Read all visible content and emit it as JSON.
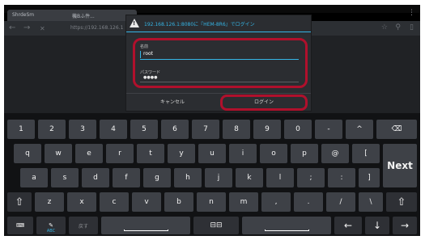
{
  "browser": {
    "tabs": [
      "ShrdeSm",
      "機Bふ件..."
    ],
    "url": "https://192.168.126.1",
    "nav_icons": {
      "back": "←",
      "forward": "→",
      "close": "✕",
      "star": "☆",
      "search": "⚲",
      "menu": "⋮"
    }
  },
  "dialog": {
    "title": "192.168.126.1:8080に『HEM-8R6』でログイン",
    "name_label": "名前",
    "name_value": "root",
    "password_label": "パスワード",
    "password_value": "●●●●",
    "cancel_label": "キャンセル",
    "login_label": "ログイン"
  },
  "keyboard": {
    "row1": [
      "1",
      "2",
      "3",
      "4",
      "5",
      "6",
      "7",
      "8",
      "9",
      "0",
      "-",
      "^",
      "⌫"
    ],
    "row2": [
      "q",
      "w",
      "e",
      "r",
      "t",
      "y",
      "u",
      "i",
      "o",
      "p",
      "@",
      "["
    ],
    "row2_enter": "Next",
    "row3": [
      "a",
      "s",
      "d",
      "f",
      "g",
      "h",
      "j",
      "k",
      "l",
      ";",
      ":",
      "]"
    ],
    "row4_shift": "⇧",
    "row4": [
      "z",
      "x",
      "c",
      "v",
      "b",
      "n",
      "m",
      ",",
      ".",
      "/",
      "\\"
    ],
    "row5": {
      "keyboard_icon": "⌨",
      "abc_label": "ABC",
      "back_label": "戻す",
      "left": "←",
      "down": "↓",
      "right": "→"
    }
  }
}
